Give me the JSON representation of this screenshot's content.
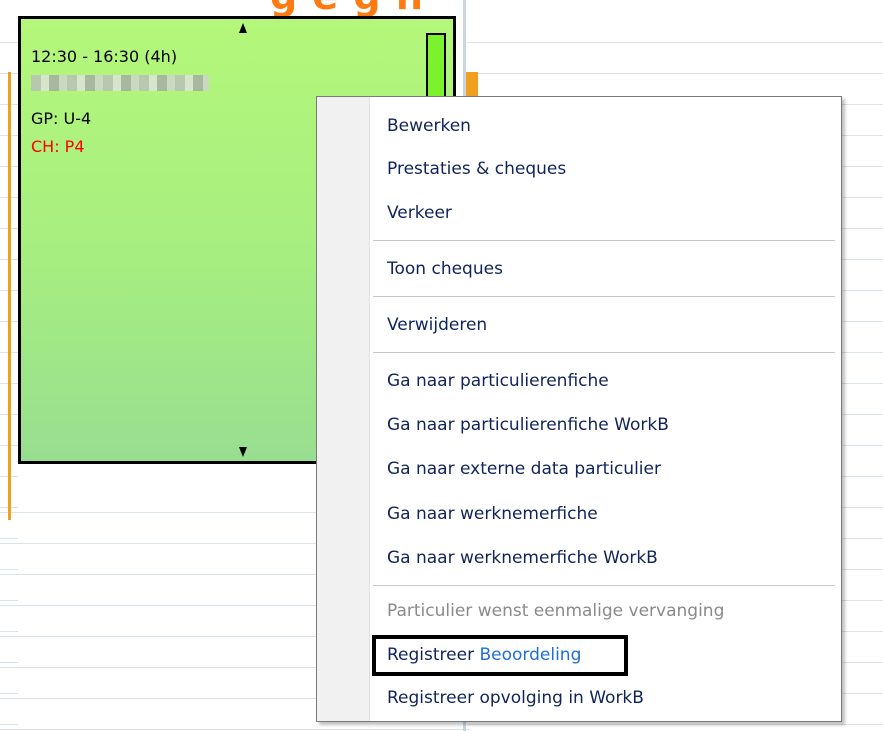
{
  "heading": "g e g  h",
  "appointment": {
    "time": "12:30 - 16:30 (4h)",
    "gp": "GP: U-4",
    "ch": "CH: P4"
  },
  "menu": {
    "items": [
      "Bewerken",
      "Prestaties & cheques",
      "Verkeer",
      "Toon cheques",
      "Verwijderen",
      "Ga naar particulierenfiche",
      "Ga naar particulierenfiche WorkB",
      "Ga naar externe data particulier",
      "Ga naar werknemerfiche",
      "Ga naar werknemerfiche WorkB",
      "Particulier wenst eenmalige vervanging"
    ],
    "registreer_prefix": "Registreer",
    "registreer_suffix": "Beoordeling",
    "last": "Registreer opvolging in WorkB"
  },
  "colors": {
    "accent_orange": "#ff7a10",
    "appointment_green": "#a6ee80",
    "menu_text": "#10245a",
    "highlight_blue": "#1f6fd6",
    "warning_red": "#ff0000"
  }
}
